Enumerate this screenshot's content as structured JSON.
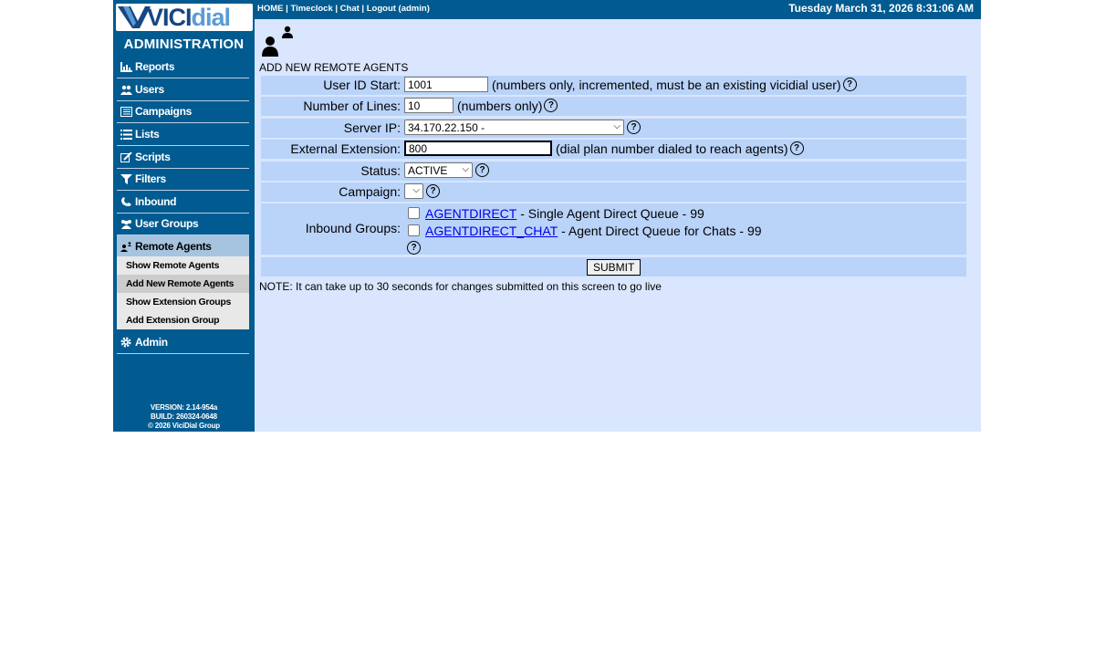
{
  "app": {
    "name": "VICIdial",
    "logo_text_vici": "VICI",
    "logo_text_dial": "dial",
    "section": "ADMINISTRATION"
  },
  "header": {
    "links": [
      "HOME",
      "Timeclock",
      "Chat",
      "Logout (admin)"
    ],
    "separator": " | ",
    "datetime": "Tuesday March 31, 2026 8:31:06 AM"
  },
  "sidebar": {
    "items": [
      {
        "label": "Reports",
        "icon": "reports-icon"
      },
      {
        "label": "Users",
        "icon": "users-icon"
      },
      {
        "label": "Campaigns",
        "icon": "campaigns-icon"
      },
      {
        "label": "Lists",
        "icon": "lists-icon"
      },
      {
        "label": "Scripts",
        "icon": "scripts-icon"
      },
      {
        "label": "Filters",
        "icon": "filter-icon"
      },
      {
        "label": "Inbound",
        "icon": "inbound-icon"
      },
      {
        "label": "User Groups",
        "icon": "user-groups-icon"
      },
      {
        "label": "Remote Agents",
        "icon": "remote-agents-icon",
        "active": true
      },
      {
        "label": "Admin",
        "icon": "gear-icon"
      }
    ],
    "subitems": [
      {
        "label": "Show Remote Agents"
      },
      {
        "label": "Add New Remote Agents",
        "active": true
      },
      {
        "label": "Show Extension Groups"
      },
      {
        "label": "Add Extension Group"
      }
    ],
    "version": "VERSION: 2.14-954a",
    "build": "BUILD: 260324-0648",
    "copyright": "© 2026 ViciDial Group"
  },
  "main": {
    "title": "ADD NEW REMOTE AGENTS",
    "form": {
      "user_id_start": {
        "label": "User ID Start:",
        "value": "1001",
        "hint": "(numbers only, incremented, must be an existing vicidial user)"
      },
      "number_of_lines": {
        "label": "Number of Lines:",
        "value": "10",
        "hint": "(numbers only)"
      },
      "server_ip": {
        "label": "Server IP:",
        "value": "34.170.22.150 -"
      },
      "external_extension": {
        "label": "External Extension:",
        "value": "800",
        "hint": "(dial plan number dialed to reach agents)"
      },
      "status": {
        "label": "Status:",
        "value": "ACTIVE"
      },
      "campaign": {
        "label": "Campaign:",
        "value": ""
      },
      "inbound_groups": {
        "label": "Inbound Groups:",
        "groups": [
          {
            "id": "AGENTDIRECT",
            "desc": " - Single Agent Direct Queue - 99",
            "checked": false
          },
          {
            "id": "AGENTDIRECT_CHAT",
            "desc": " - Agent Direct Queue for Chats - 99",
            "checked": false
          }
        ]
      },
      "submit_label": "SUBMIT"
    },
    "note": "NOTE: It can take up to 30 seconds for changes submitted on this screen to go live",
    "help_glyph": "?"
  },
  "colors": {
    "nav_bg": "#015b91",
    "content_bg": "#d9e6fe",
    "row_bg": "#b9d3f9",
    "active_nav": "#a6c4df"
  }
}
